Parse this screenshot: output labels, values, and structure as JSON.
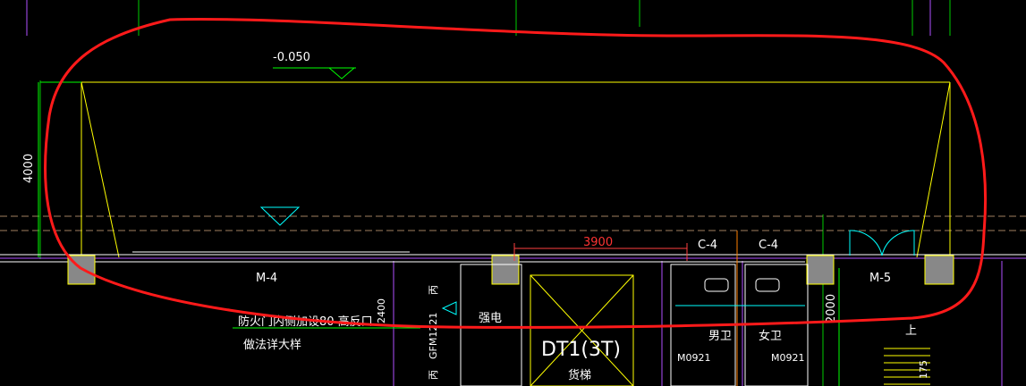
{
  "drawing": {
    "elevation_label": "-0.050",
    "vertical_dimension": "4000",
    "horizontal_dimension": "3900",
    "right_dimension": "2000",
    "small_dimension": "2400",
    "door_left": "M-4",
    "door_right": "M-5",
    "window_a": "C-4",
    "window_b": "C-4",
    "room_electric": "强电",
    "room_lift_code": "DT1(3T)",
    "room_lift_name": "货梯",
    "room_male_wc": "男卫",
    "room_female_wc": "女卫",
    "door_code_a": "M0921",
    "door_code_b": "M0921",
    "fire_door": "GFM1221",
    "fire_class": "丙",
    "note_line1": "防火门内侧加设80 高反口",
    "note_line2": "做法详大样",
    "stair_up": "上",
    "stair_dim": "175"
  },
  "colors": {
    "background": "#000000",
    "yellow": "#ffff00",
    "white": "#ffffff",
    "green": "#00ff00",
    "magenta": "#c040ff",
    "cyan": "#00ffff",
    "red": "#ff0000",
    "column": "#999999"
  }
}
